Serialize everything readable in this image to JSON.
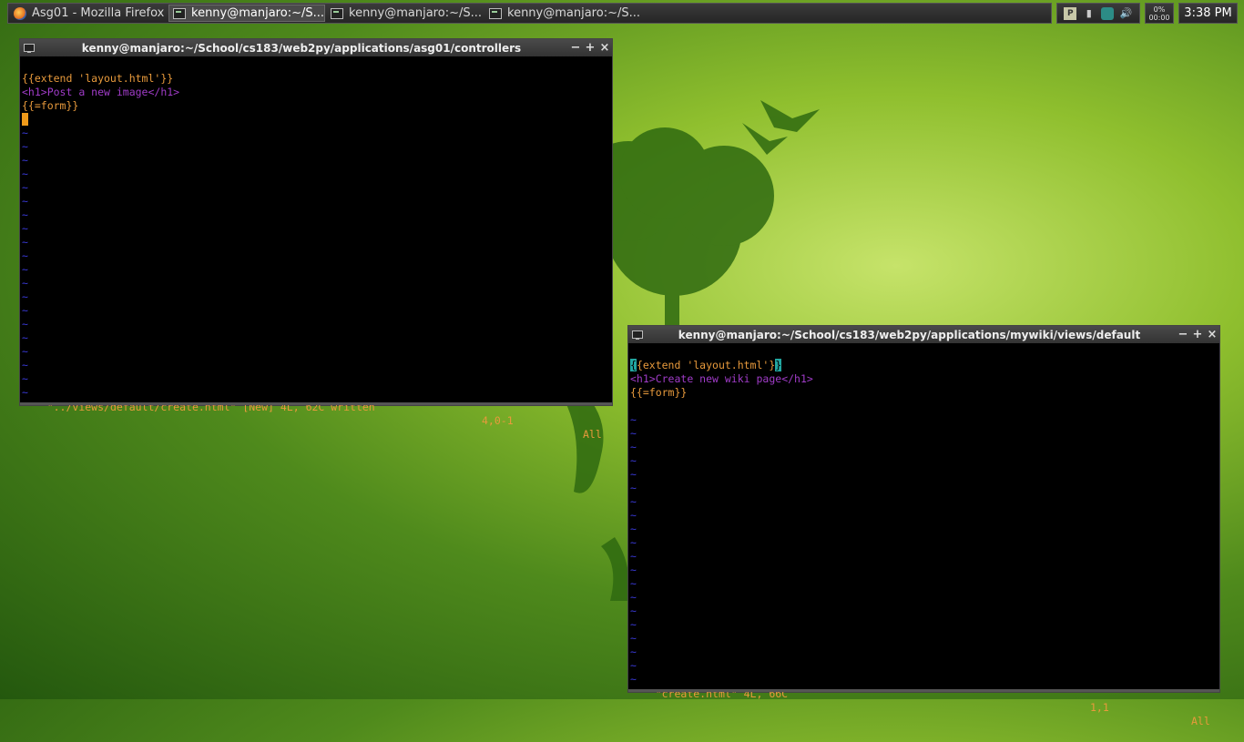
{
  "taskbar": {
    "tasks": [
      {
        "label": "Asg01 - Mozilla Firefox",
        "icon": "firefox-icon",
        "active": false
      },
      {
        "label": "kenny@manjaro:~/S...",
        "icon": "terminal-icon",
        "active": true
      },
      {
        "label": "kenny@manjaro:~/S...",
        "icon": "terminal-icon",
        "active": false
      },
      {
        "label": "kenny@manjaro:~/S...",
        "icon": "terminal-icon",
        "active": false
      }
    ]
  },
  "tray": {
    "icons": [
      "battery-icon",
      "signal-icon",
      "network-icon",
      "volume-icon"
    ]
  },
  "cpu": {
    "percent": "0%",
    "time": "00:00"
  },
  "clock": {
    "time": "3:38 PM"
  },
  "window1": {
    "title": "kenny@manjaro:~/School/cs183/web2py/applications/asg01/controllers",
    "lines": {
      "line1": "{{extend 'layout.html'}}",
      "line2_open": "<h1>",
      "line2_text": "Post a new image",
      "line2_close": "</h1>",
      "line3": "{{=form}}"
    },
    "status": "\"../views/default/create.html\" [New] 4L, 62C written",
    "cursor_pos": "4,0-1",
    "scroll": "All"
  },
  "window2": {
    "title": "kenny@manjaro:~/School/cs183/web2py/applications/mywiki/views/default",
    "lines": {
      "line1_first": "{",
      "line1_mid": "{extend 'layout.html'}",
      "line1_last": "}",
      "line2_open": "<h1>",
      "line2_text": "Create new wiki page",
      "line2_close": "</h1>",
      "line3": "{{=form}}"
    },
    "status": "\"create.html\" 4L, 66C",
    "cursor_pos": "1,1",
    "scroll": "All"
  },
  "window_controls": {
    "minimize": "−",
    "maximize": "+",
    "close": "×"
  },
  "tilde": "~"
}
